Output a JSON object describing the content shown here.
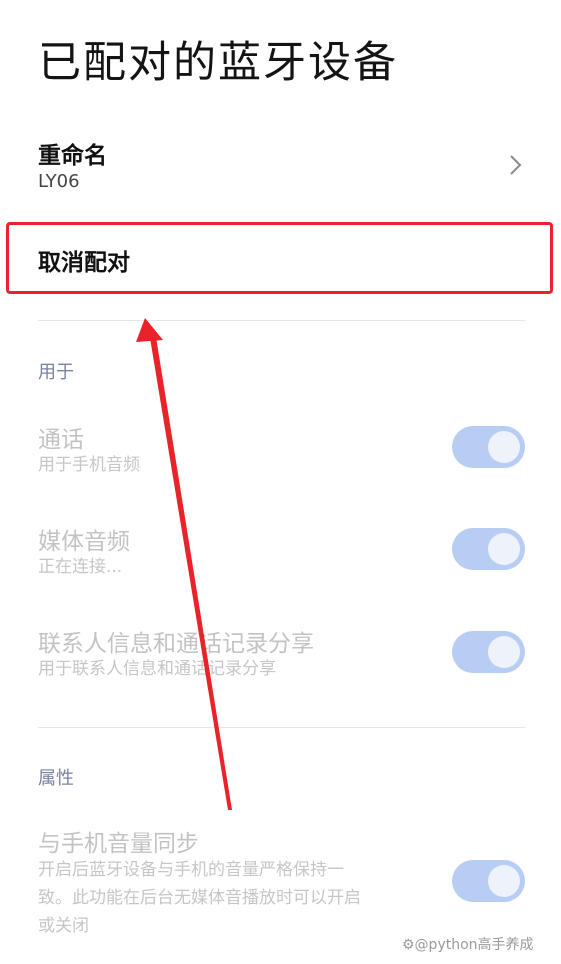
{
  "page": {
    "title": "已配对的蓝牙设备"
  },
  "rename": {
    "label": "重命名",
    "value": "LY06"
  },
  "unpair": {
    "label": "取消配对"
  },
  "sections": {
    "used_for": "用于",
    "properties": "属性"
  },
  "items": {
    "call": {
      "title": "通话",
      "subtitle": "用于手机音频",
      "enabled": true
    },
    "media": {
      "title": "媒体音频",
      "subtitle": "正在连接...",
      "enabled": true
    },
    "contacts": {
      "title": "联系人信息和通话记录分享",
      "subtitle": "用于联系人信息和通话记录分享",
      "enabled": true
    },
    "volume_sync": {
      "title": "与手机音量同步",
      "subtitle_line1": "开启后蓝牙设备与手机的音量严格保持一",
      "subtitle_line2": "致。此功能在后台无媒体音播放时可以开启",
      "subtitle_line3": "或关闭",
      "enabled": true
    }
  },
  "watermark": "⚙@python高手养成",
  "colors": {
    "highlight": "#e8232a",
    "toggle_track": "#b8cdf3",
    "section_header": "#7a82a0"
  }
}
